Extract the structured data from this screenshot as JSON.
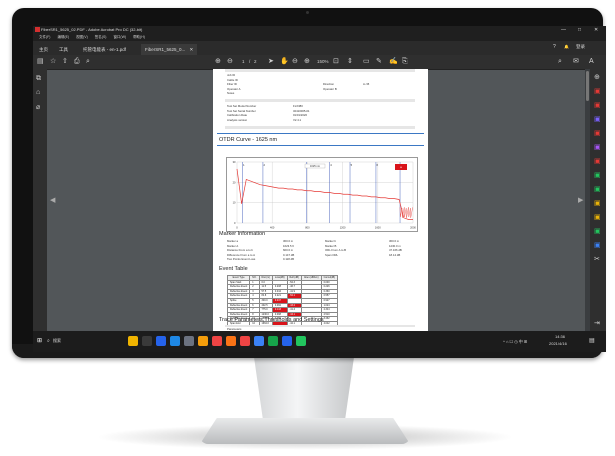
{
  "window": {
    "title": "FiberSR1_5625_02.PDF - Adobe Acrobat Pro DC (32-bit)",
    "controls": [
      "—",
      "□",
      "✕"
    ]
  },
  "menu": [
    "文件(F)",
    "编辑(E)",
    "视图(V)",
    "签名(S)",
    "窗口(W)",
    "帮助(H)"
  ],
  "tabs": {
    "home": "主页",
    "tools": "工具",
    "doc1": "托管电能表 - en-1.pdf",
    "doc2": "FiberSR1_5625_0...",
    "doc2_close": "✕",
    "help": "?",
    "login": "登录"
  },
  "toolbar": {
    "page_current": "1",
    "page_sep": "/",
    "page_total": "2",
    "zoom": "150%"
  },
  "taskbar": {
    "search": "搜索",
    "time": "14:36",
    "date": "2021/4/16"
  },
  "doc": {
    "info_rows": [
      {
        "label": "Job ID",
        "value": ""
      },
      {
        "label": "Cable ID",
        "value": ""
      },
      {
        "label": "Fiber ID",
        "value": "",
        "label2": "Direction",
        "value2": "A->B"
      },
      {
        "label": "Operator A",
        "value": "",
        "label2": "Operator B",
        "value2": ""
      },
      {
        "label": "Notes",
        "value": ""
      }
    ],
    "set_rows": [
      {
        "label": "Test Set Model Number",
        "value": "FLX380"
      },
      {
        "label": "Test Set Serial Number",
        "value": "32410005-01"
      },
      {
        "label": "Calibration Date",
        "value": "01/01/2020"
      },
      {
        "label": "Analysis version",
        "value": "V2.4.1"
      }
    ],
    "otdr_title": "OTDR Curve - 1625 nm",
    "chart_tag": "1625 nm",
    "chart_legend": "×",
    "marker_title": "Marker Information",
    "marker_rows": [
      {
        "l1": "Marker a",
        "v1": "300.0 m",
        "l2": "Marker b",
        "v2": "300.0 m"
      },
      {
        "l1": "Marker A",
        "v1": "1623.5 ft",
        "l2": "Marker B",
        "v2": "1230.0 m"
      },
      {
        "l1": "Distance From a to b",
        "v1": "600.0 m",
        "l2": "ORL From A to B",
        "v2": "47.166 dB"
      },
      {
        "l1": "Difference From a to A",
        "v1": "0.147 dB",
        "l2": "Span ORL",
        "v2": "18.14 dB"
      },
      {
        "l1": "Two Points Event Loss",
        "v1": "0.118 dB",
        "l2": "",
        "v2": ""
      }
    ],
    "event_title": "Event Table",
    "event_headers": [
      "Event Type",
      "NO.",
      "Dist.(m)",
      "Loss(dB)",
      "Refl.(dB)",
      "Atten.(dB/km)",
      "Cumul(dB)"
    ],
    "event_rows": [
      [
        "Span Start",
        "1",
        "0.0",
        "",
        "-52.3",
        "",
        "0.000"
      ],
      [
        "Reflective Event",
        "2",
        "11.5",
        "0.208",
        "-46.7",
        "",
        "0.226"
      ],
      [
        "Reflective Event",
        "3",
        "57.5",
        "0.044",
        "-41.9",
        "",
        "0.360"
      ],
      [
        "Reflective Event",
        "4",
        "84.8",
        "0.221",
        "-52.1",
        "",
        "0.557"
      ],
      [
        "Splice",
        "5",
        "300.0",
        "0.047",
        "",
        "",
        "0.927"
      ],
      [
        "Reflective Event",
        "6",
        "402.5",
        "0.092",
        "-43.2",
        "",
        "1.024"
      ],
      [
        "Reflective Event",
        "7",
        "775.0",
        "0.143",
        "-41.4",
        "",
        "2.344"
      ],
      [
        "Reflective Event",
        "8",
        "1230.0",
        "0.098",
        "-44.1",
        "",
        "2.510"
      ],
      [
        "Reflective Event",
        "9",
        "1561.0",
        "0.412",
        "",
        "",
        "3.462"
      ],
      [
        "Span End",
        "10",
        "1964.0",
        "",
        "-42.1",
        "",
        "4.042"
      ]
    ],
    "event_red_cells": [
      [
        3,
        4
      ],
      [
        4,
        3
      ],
      [
        5,
        4
      ],
      [
        6,
        3
      ],
      [
        7,
        4
      ],
      [
        9,
        3
      ]
    ],
    "trace_title": "Trace Parameters,Thresholds and Settings",
    "param_head": "Parameters",
    "param_rows": [
      {
        "l1": "Wavelength",
        "v1": "1625 nm",
        "l2": "Pulse Width",
        "v2": "8 ns"
      },
      {
        "l1": "Range",
        "v1": "2000.0 m",
        "l2": "Avg. Time",
        "v2": "15 sec"
      }
    ]
  },
  "chart_data": {
    "type": "line",
    "x": [
      0,
      5,
      10,
      15,
      20,
      25,
      30,
      35,
      40,
      45,
      50,
      55,
      60,
      65,
      70,
      75,
      80,
      85,
      90,
      95,
      100,
      105,
      110,
      115,
      120,
      125,
      130,
      135,
      140,
      145,
      150,
      155,
      160,
      165,
      170,
      175,
      180,
      185,
      190
    ],
    "series": [
      {
        "values": [
          8,
          48,
          20,
          22,
          24,
          26,
          27,
          28,
          29,
          30,
          30,
          31,
          31,
          32,
          32,
          33,
          33,
          34,
          34,
          35,
          35,
          36,
          36,
          37,
          37,
          38,
          38,
          39,
          39,
          40,
          40,
          41,
          41,
          42,
          42,
          43,
          64,
          66,
          66
        ]
      }
    ],
    "event_x": [
      6,
      28,
      75,
      100,
      122,
      150,
      176
    ],
    "event_labels": [
      "1",
      "2",
      "3",
      "4",
      "5",
      "6",
      "7"
    ],
    "ylim": [
      0,
      70
    ],
    "xlim": [
      0,
      190
    ],
    "x_tick_labels": [
      "0",
      "400",
      "800",
      "1200",
      "1600",
      "2000"
    ],
    "y_tick_labels": [
      "30",
      "20",
      "10",
      "0"
    ],
    "colors": {
      "trace": "#e53935",
      "events": "#1e40af",
      "grid": "#bbbbbb"
    }
  }
}
